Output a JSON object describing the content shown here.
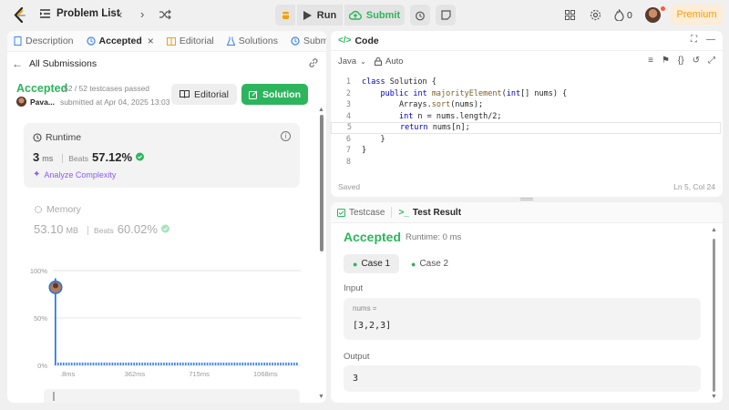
{
  "topbar": {
    "problem_list": "Problem List",
    "run": "Run",
    "submit": "Submit",
    "premium": "Premium",
    "streak": "0"
  },
  "left": {
    "tabs": [
      {
        "label": "Description",
        "icon": "description-icon"
      },
      {
        "label": "Accepted",
        "icon": "history-icon",
        "close": "×"
      },
      {
        "label": "Editorial",
        "icon": "editorial-icon"
      },
      {
        "label": "Solutions",
        "icon": "flask-icon"
      },
      {
        "label": "Submissions",
        "icon": "history-icon"
      }
    ],
    "back_label": "All Submissions",
    "status": "Accepted",
    "testcases": "52 / 52 testcases passed",
    "user": "Pava...",
    "submitted": "submitted at Apr 04, 2025 13:03",
    "editorial_btn": "Editorial",
    "solution_btn": "Solution",
    "runtime": {
      "label": "Runtime",
      "value": "3",
      "unit": "ms",
      "beats_label": "Beats",
      "beats": "57.12%",
      "analyze": "Analyze Complexity"
    },
    "memory": {
      "label": "Memory",
      "value": "53.10",
      "unit": "MB",
      "beats_label": "Beats",
      "beats": "60.02%"
    }
  },
  "chart_data": {
    "type": "bar",
    "y_ticks": [
      "100%",
      "50%",
      "0%"
    ],
    "x_ticks": [
      ".8ms",
      "362ms",
      "715ms",
      "1068ms"
    ],
    "ylim": [
      0,
      100
    ],
    "highlight_bar_index": 0,
    "values": [
      92,
      3,
      3,
      3,
      3,
      3,
      3,
      3,
      3,
      3,
      3,
      3,
      3,
      3,
      3,
      3,
      3,
      3,
      3,
      3,
      3,
      3,
      3,
      3,
      3,
      3,
      3,
      3,
      3,
      3,
      3,
      3,
      3,
      3,
      3,
      3,
      3,
      3,
      3,
      3,
      3,
      3,
      3,
      3,
      3,
      3,
      3,
      3,
      3,
      3,
      3,
      3,
      3,
      3,
      3,
      3,
      3,
      3,
      3,
      3,
      3,
      3,
      3,
      3,
      3,
      3,
      3,
      3,
      3,
      3,
      3,
      3,
      3,
      3,
      3,
      3,
      3,
      3,
      3,
      3,
      3,
      3,
      3,
      3,
      3,
      3,
      3,
      3,
      3,
      3
    ]
  },
  "code": {
    "title": "Code",
    "language": "Java",
    "mode": "Auto",
    "lines": [
      {
        "n": "1",
        "html": "<span class='kw'>class</span> Solution {"
      },
      {
        "n": "2",
        "html": "    <span class='kw'>public</span> <span class='kw'>int</span> <span class='fn'>majorityElement</span>(<span class='kw'>int</span>[] nums) {"
      },
      {
        "n": "3",
        "html": "        Arrays.<span class='fn'>sort</span>(nums);"
      },
      {
        "n": "4",
        "html": "        <span class='kw'>int</span> n = nums.length/2;"
      },
      {
        "n": "5",
        "html": "        <span class='kw'>return</span> nums[n];"
      },
      {
        "n": "6",
        "html": "    }"
      },
      {
        "n": "7",
        "html": "}"
      },
      {
        "n": "8",
        "html": ""
      }
    ],
    "saved": "Saved",
    "cursor": "Ln 5, Col 24"
  },
  "result": {
    "tab_testcase": "Testcase",
    "tab_result": "Test Result",
    "status": "Accepted",
    "runtime": "Runtime: 0 ms",
    "case1": "Case 1",
    "case2": "Case 2",
    "input_label": "Input",
    "var_name": "nums =",
    "input_value": "[3,2,3]",
    "output_label": "Output",
    "output_value": "3"
  }
}
